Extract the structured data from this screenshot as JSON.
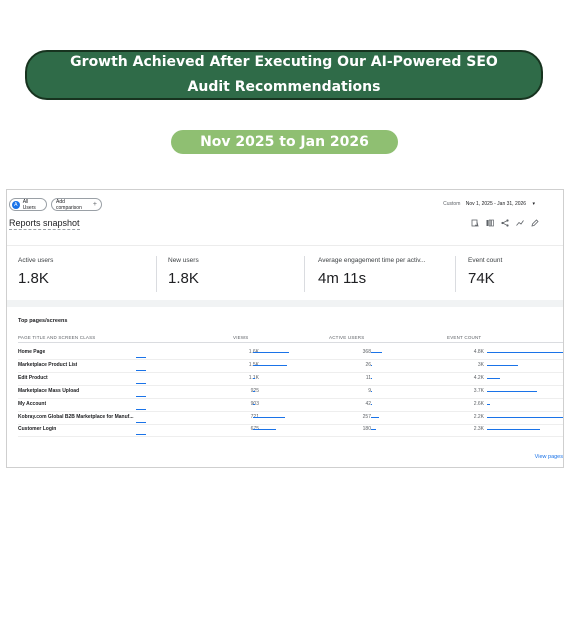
{
  "banner": {
    "text": "Growth Achieved After Executing Our AI-Powered SEO Audit Recommendations"
  },
  "date_pill": {
    "text": "Nov 2025 to Jan 2026"
  },
  "colors": {
    "banner_bg": "#2f6b48",
    "pill_bg": "#8fbf72",
    "accent_blue": "#1a73e8"
  },
  "analytics": {
    "all_users_chip": "All Users",
    "all_users_avatar": "A",
    "add_comparison": "Add comparison",
    "add_icon": "+",
    "date_label": "Custom",
    "date_range": "Nov 1, 2025 - Jan 31, 2026",
    "caret": "▾",
    "report_title": "Reports snapshot",
    "icons": [
      "compare-icon",
      "customize-icon",
      "share-icon",
      "insights-icon",
      "edit-icon"
    ],
    "metrics": [
      {
        "label": "Active users",
        "value": "1.8K"
      },
      {
        "label": "New users",
        "value": "1.8K"
      },
      {
        "label": "Average engagement time per activ...",
        "value": "4m 11s"
      },
      {
        "label": "Event count",
        "value": "74K"
      }
    ],
    "table": {
      "title": "Top pages/screens",
      "headers": [
        "PAGE TITLE AND SCREEN CLASS",
        "VIEWS",
        "ACTIVE USERS",
        "EVENT COUNT"
      ],
      "rows": [
        {
          "page": "Home Page",
          "views": "1.6K",
          "views_frac": 1.0,
          "users": "368",
          "users_frac": 1.0,
          "events": "4.8K",
          "events_frac": 1.0
        },
        {
          "page": "Marketplace Product List",
          "views": "1.5K",
          "views_frac": 0.94,
          "users": "26",
          "users_frac": 0.07,
          "events": "3K",
          "events_frac": 0.4
        },
        {
          "page": "Edit Product",
          "views": "1.1K",
          "views_frac": 0.05,
          "users": "11",
          "users_frac": 0.03,
          "events": "4.2K",
          "events_frac": 0.17
        },
        {
          "page": "Marketplace Mass Upload",
          "views": "925",
          "views_frac": 0.05,
          "users": "9",
          "users_frac": 0.03,
          "events": "3.7K",
          "events_frac": 0.64
        },
        {
          "page": "My Account",
          "views": "903",
          "views_frac": 0.05,
          "users": "42",
          "users_frac": 0.11,
          "events": "2.6K",
          "events_frac": 0.04
        },
        {
          "page": "Kobray.com Global B2B Marketplace for Manuf...",
          "views": "721",
          "views_frac": 0.9,
          "users": "257",
          "users_frac": 0.7,
          "events": "2.2K",
          "events_frac": 1.0
        },
        {
          "page": "Customer Login",
          "views": "675",
          "views_frac": 0.65,
          "users": "180",
          "users_frac": 0.49,
          "events": "2.3K",
          "events_frac": 0.68
        }
      ]
    },
    "view_link": "View pages"
  }
}
